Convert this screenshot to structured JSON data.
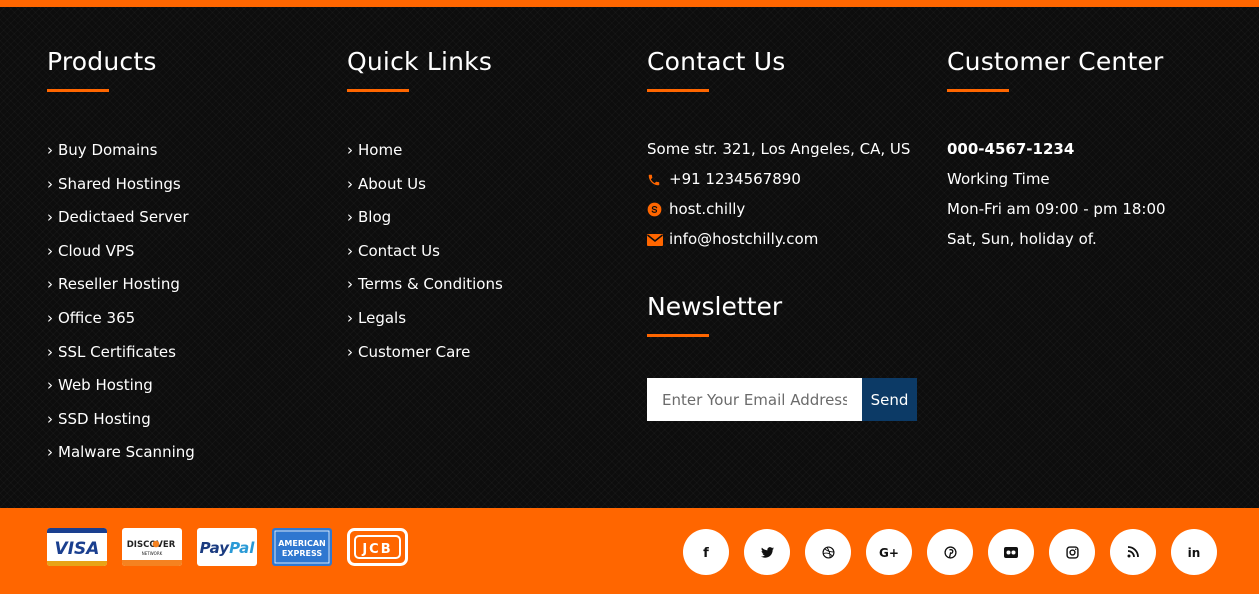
{
  "colors": {
    "accent": "#ff6600",
    "background": "#0d0d0d",
    "send_button": "#0c3a66",
    "text": "#ffffff"
  },
  "products": {
    "title": "Products",
    "items": [
      "Buy Domains",
      "Shared Hostings",
      "Dedictaed Server",
      "Cloud VPS",
      "Reseller Hosting",
      "Office 365",
      "SSL Certificates",
      "Web Hosting",
      "SSD Hosting",
      "Malware Scanning"
    ]
  },
  "quick_links": {
    "title": "Quick Links",
    "items": [
      "Home",
      "About Us",
      "Blog",
      "Contact Us",
      "Terms & Conditions",
      "Legals",
      "Customer Care"
    ]
  },
  "contact": {
    "title": "Contact Us",
    "address": "Some str. 321, Los Angeles, CA, US",
    "phone": "+91 1234567890",
    "skype": "host.chilly",
    "email": "info@hostchilly.com",
    "icons": [
      "phone-icon",
      "skype-icon",
      "envelope-icon"
    ]
  },
  "newsletter": {
    "title": "Newsletter",
    "placeholder": "Enter Your Email Address",
    "value": "",
    "button": "Send"
  },
  "customer_center": {
    "title": "Customer Center",
    "phone": "000-4567-1234",
    "working_time_label": "Working Time",
    "weekdays": "Mon-Fri am 09:00 - pm 18:00",
    "weekend": "Sat, Sun, holiday of."
  },
  "payment_methods": {
    "visa": "VISA",
    "discover": "DISCOVER",
    "discover_sub": "NETWORK",
    "paypal_1": "Pay",
    "paypal_2": "Pal",
    "amex_1": "AMERICAN",
    "amex_2": "EXPRESS",
    "jcb": "JCB"
  },
  "social_icons": [
    "facebook-icon",
    "twitter-icon",
    "dribbble-icon",
    "google-plus-icon",
    "pinterest-icon",
    "flickr-icon",
    "instagram-icon",
    "rss-icon",
    "linkedin-icon"
  ],
  "social_glyphs": {
    "facebook": "f",
    "google_plus": "G+",
    "linkedin": "in"
  }
}
